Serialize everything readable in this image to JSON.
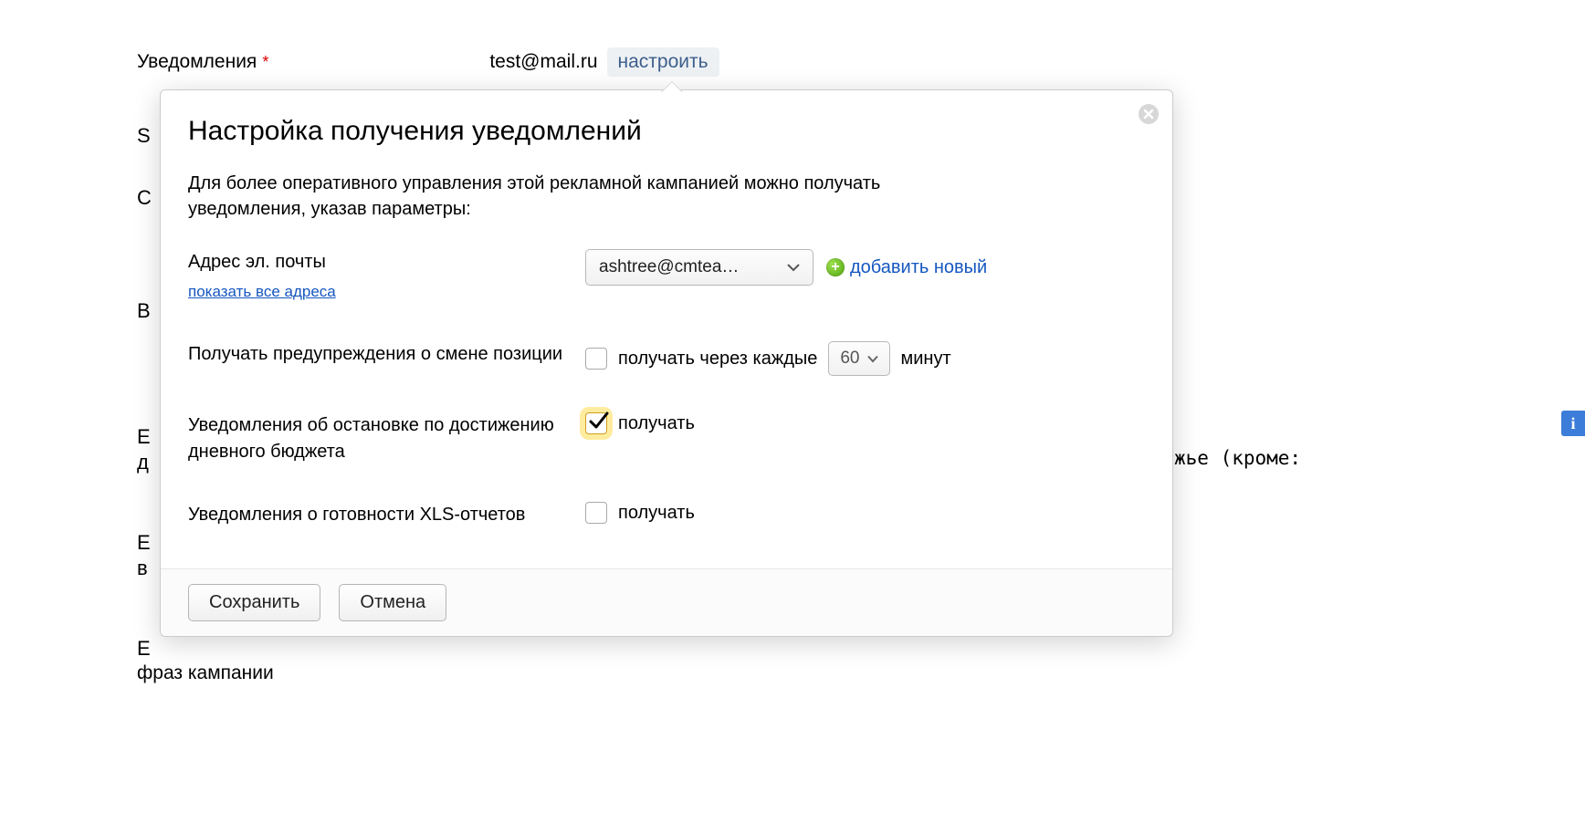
{
  "background": {
    "notifications_label": "Уведомления",
    "email_value": "test@mail.ru",
    "configure_label": "настроить",
    "letters": {
      "s": "S",
      "c": "C",
      "b": "В",
      "e1": "Е",
      "d": "д",
      "e2": "Е",
      "v": "в",
      "e3": "Е"
    },
    "phrase_line": "фраз кампании",
    "right_tail": "жье (кроме:"
  },
  "popover": {
    "title": "Настройка получения уведомлений",
    "description": "Для более оперативного управления этой рекламной кампанией можно получать уведомления, указав параметры:",
    "email": {
      "label": "Адрес эл. почты",
      "show_all": "показать все адреса",
      "selected": "ashtree@cmtea…",
      "add_new": "добавить новый"
    },
    "position": {
      "label": "Получать предупреждения о смене позиции",
      "checkbox_label": "получать через каждые",
      "interval_value": "60",
      "interval_unit": "минут",
      "checked": false
    },
    "budget": {
      "label": "Уведомления об остановке по достижению дневного бюджета",
      "checkbox_label": "получать",
      "checked": true
    },
    "xls": {
      "label": "Уведомления о готовности XLS-отчетов",
      "checkbox_label": "получать",
      "checked": false
    },
    "save_label": "Сохранить",
    "cancel_label": "Отмена"
  },
  "info_tab": "i"
}
